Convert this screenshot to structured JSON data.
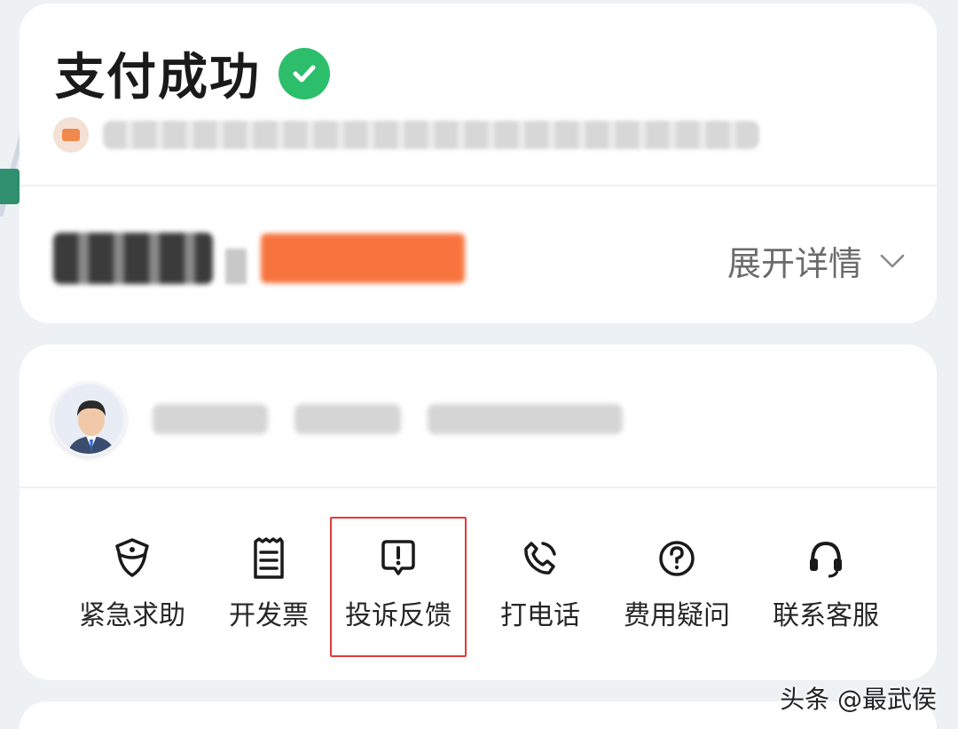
{
  "payment": {
    "title": "支付成功",
    "detail_toggle": "展开详情"
  },
  "actions": [
    {
      "label": "紧急求助",
      "icon": "shield-icon"
    },
    {
      "label": "开发票",
      "icon": "receipt-icon"
    },
    {
      "label": "投诉反馈",
      "icon": "feedback-icon"
    },
    {
      "label": "打电话",
      "icon": "phone-icon"
    },
    {
      "label": "费用疑问",
      "icon": "question-icon"
    },
    {
      "label": "联系客服",
      "icon": "headset-icon"
    }
  ],
  "highlighted_action": "投诉反馈",
  "watermark": "头条 @最武侯",
  "colors": {
    "success_green": "#2dbe6c",
    "highlight_red": "#e23a3a",
    "coupon_orange": "#f7743f"
  }
}
